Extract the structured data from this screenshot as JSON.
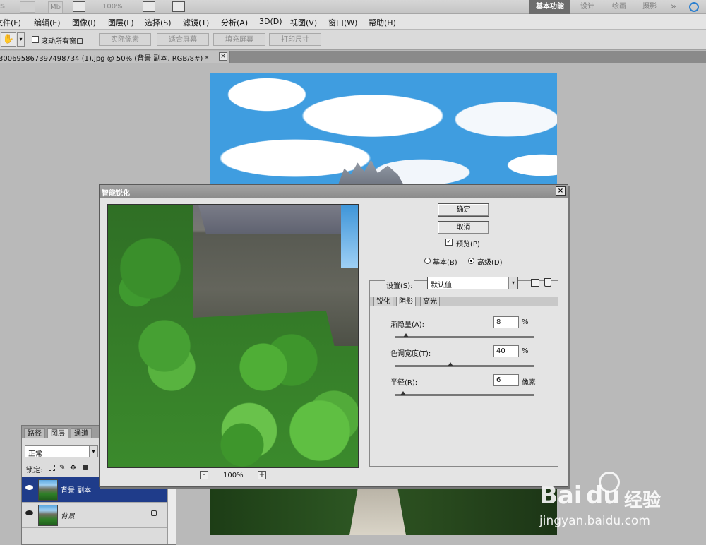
{
  "appbar": {
    "ps_fragment": "S",
    "mini_badge": "Mb",
    "zoom": "100%",
    "workspaces": [
      "基本功能",
      "设计",
      "绘画",
      "摄影"
    ],
    "more": "»"
  },
  "menu": [
    "文件(F)",
    "编辑(E)",
    "图像(I)",
    "图层(L)",
    "选择(S)",
    "滤镜(T)",
    "分析(A)",
    "3D(D)",
    "视图(V)",
    "窗口(W)",
    "帮助(H)"
  ],
  "options": {
    "scroll_all": "滚动所有窗口",
    "buttons": [
      "实际像素",
      "适合屏幕",
      "填充屏幕",
      "打印尺寸"
    ]
  },
  "document_tab": {
    "title": "300695867397498734 (1).jpg @ 50% (背景 副本, RGB/8#) *",
    "close": "×"
  },
  "layers_panel": {
    "tabs": [
      "路径",
      "图层",
      "通道"
    ],
    "blend_mode": "正常",
    "lock_label": "锁定:",
    "layers": [
      {
        "name": "背景 副本",
        "selected": true
      },
      {
        "name": "背景",
        "selected": false,
        "locked": true
      }
    ]
  },
  "dialog": {
    "title": "智能锐化",
    "close": "×",
    "ok": "确定",
    "cancel": "取消",
    "preview_label": "预览(P)",
    "preview_checked": true,
    "mode_basic": "基本(B)",
    "mode_advanced": "高级(D)",
    "mode_selected": "advanced",
    "settings_label": "设置(S):",
    "settings_value": "默认值",
    "tabs": [
      "锐化",
      "阴影",
      "高光"
    ],
    "active_tab": "阴影",
    "params": [
      {
        "label": "渐隐量(A):",
        "value": "8",
        "unit": "%",
        "slider": 0.08
      },
      {
        "label": "色调宽度(T):",
        "value": "40",
        "unit": "%",
        "slider": 0.4
      },
      {
        "label": "半径(R):",
        "value": "6",
        "unit": "像素",
        "slider": 0.06
      }
    ],
    "zoom_value": "100%",
    "zoom_out": "-",
    "zoom_in": "+"
  },
  "watermark": {
    "brand": "Bai",
    "brand2": "du",
    "cn": "经验",
    "url": "jingyan.baidu.com"
  }
}
